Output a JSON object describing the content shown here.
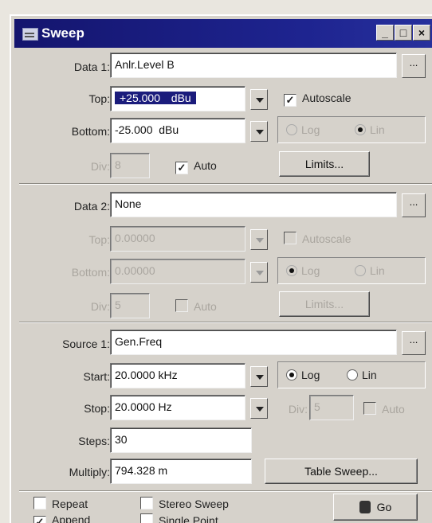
{
  "window": {
    "title": "Sweep",
    "min": "_",
    "max": "□",
    "close": "×"
  },
  "data1": {
    "label": "Data 1:",
    "value": "Anlr.Level B",
    "ellipsis": "...",
    "top_label": "Top:",
    "top_value": "+25.000",
    "top_unit": "dBu",
    "autoscale_label": "Autoscale",
    "autoscale_checked": "✓",
    "bottom_label": "Bottom:",
    "bottom_value": "-25.000",
    "bottom_unit": "dBu",
    "log_label": "Log",
    "lin_label": "Lin",
    "div_label": "Div:",
    "div_value": "8",
    "auto_label": "Auto",
    "auto_checked": "✓",
    "limits_label": "Limits..."
  },
  "data2": {
    "label": "Data 2:",
    "value": "None",
    "ellipsis": "...",
    "top_label": "Top:",
    "top_value": "0.00000",
    "autoscale_label": "Autoscale",
    "bottom_label": "Bottom:",
    "bottom_value": "0.00000",
    "log_label": "Log",
    "lin_label": "Lin",
    "div_label": "Div:",
    "div_value": "5",
    "auto_label": "Auto",
    "limits_label": "Limits..."
  },
  "source1": {
    "label": "Source 1:",
    "value": "Gen.Freq",
    "ellipsis": "...",
    "start_label": "Start:",
    "start_value": "20.0000 kHz",
    "stop_label": "Stop:",
    "stop_value": "20.0000  Hz",
    "log_label": "Log",
    "lin_label": "Lin",
    "div_label": "Div:",
    "div_value": "5",
    "auto_label": "Auto",
    "steps_label": "Steps:",
    "steps_value": "30",
    "multiply_label": "Multiply:",
    "multiply_value": "794.328 m",
    "table_sweep_label": "Table Sweep..."
  },
  "options": {
    "repeat": "Repeat",
    "stereo_sweep": "Stereo Sweep",
    "append": "Append",
    "append_checked": "✓",
    "single_point": "Single Point",
    "go_label": "Go"
  }
}
